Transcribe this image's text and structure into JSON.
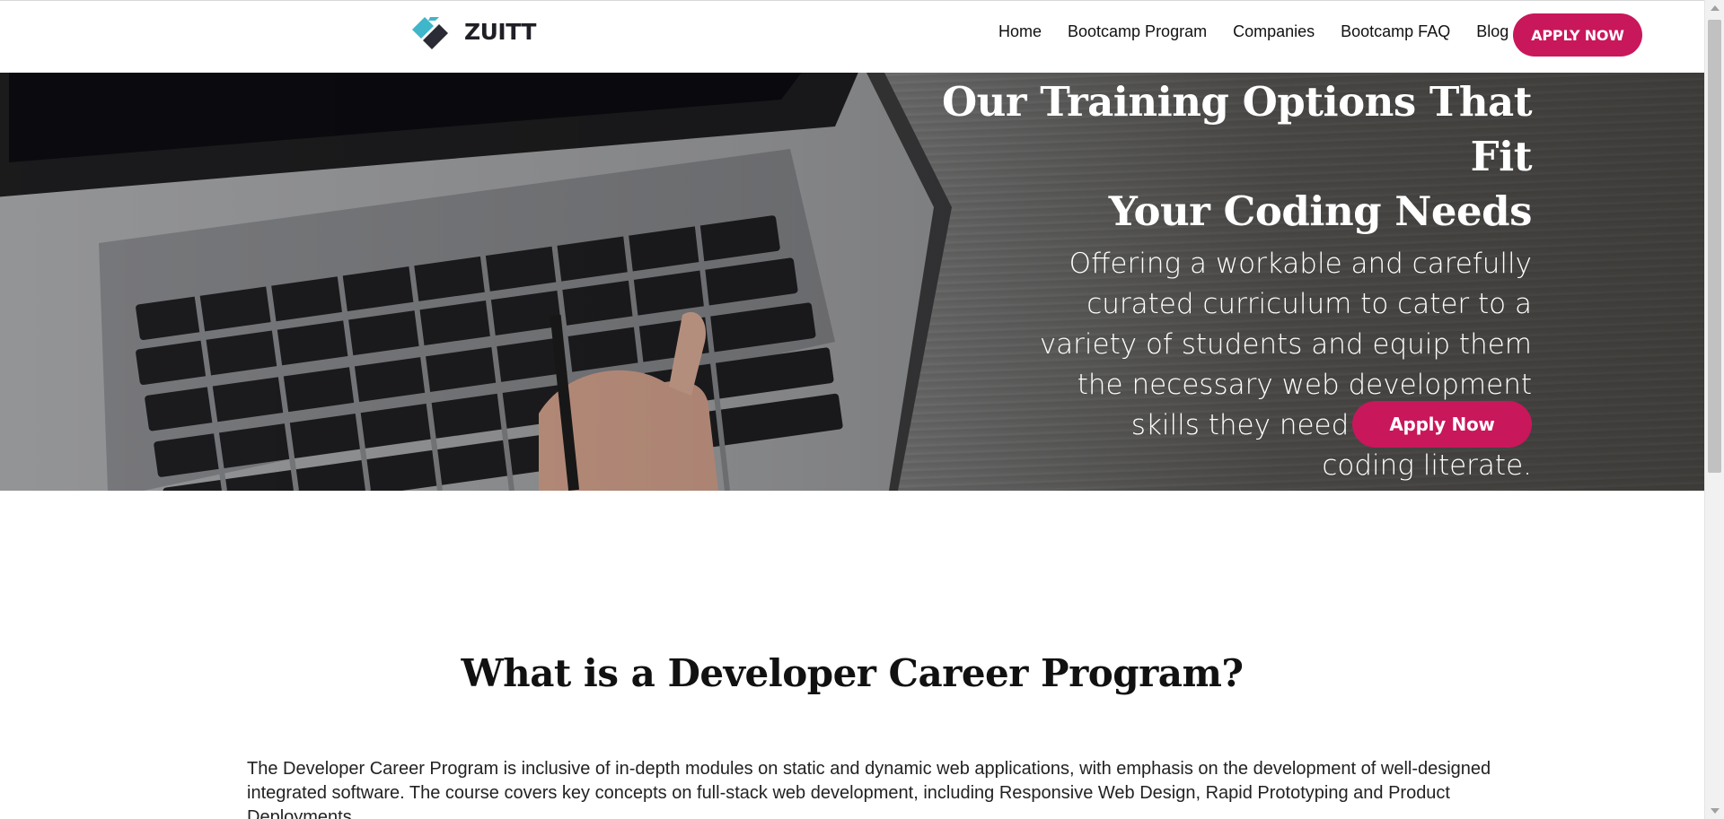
{
  "navbar": {
    "logo_text": "ZUITT",
    "links": [
      "Home",
      "Bootcamp Program",
      "Companies",
      "Bootcamp FAQ",
      "Blog"
    ],
    "apply_label": "APPLY NOW"
  },
  "hero": {
    "title_line1": "Our Training Options That Fit",
    "title_line2": "Your Coding Needs",
    "subtitle": "Offering a workable and carefully curated curriculum to cater to a variety of students and equip them the necessary web development skills they need to become a coding literate.",
    "apply_label": "Apply Now"
  },
  "section": {
    "title": "What is a Developer Career Program?",
    "body": "The Developer Career Program is inclusive of in-depth modules on static and dynamic web applications, with emphasis on the development of well-designed integrated software. The course covers key concepts on full-stack web development, including Responsive Web Design, Rapid Prototyping and Product Deployments."
  },
  "colors": {
    "accent": "#c9175b",
    "nav_text": "#111111",
    "logo_teal": "#3fb6c9",
    "logo_dark": "#2b2b35"
  },
  "icons": {
    "logo": "zuitt-logo-icon"
  }
}
